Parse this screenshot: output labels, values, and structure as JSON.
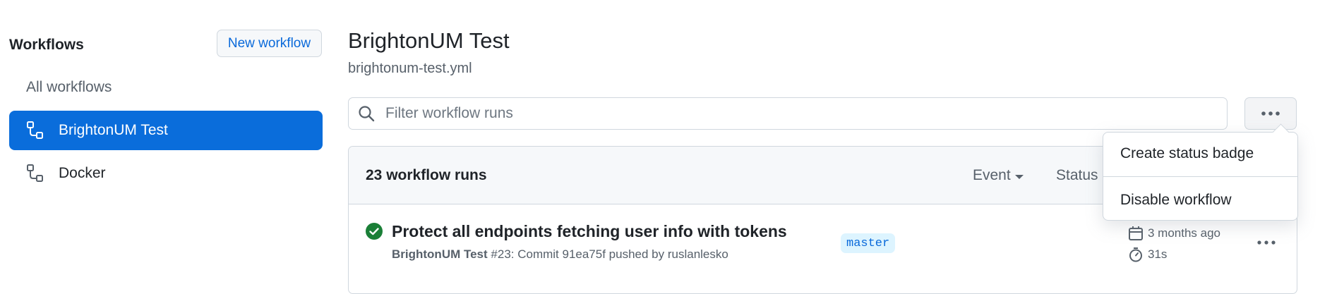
{
  "sidebar": {
    "title": "Workflows",
    "new_workflow_label": "New workflow",
    "items": [
      {
        "label": "All workflows"
      },
      {
        "label": "BrightonUM Test",
        "active": true,
        "icon": "workflow-icon"
      },
      {
        "label": "Docker",
        "icon": "workflow-icon"
      }
    ]
  },
  "header": {
    "title": "BrightonUM Test",
    "filename": "brightonum-test.yml"
  },
  "search": {
    "placeholder": "Filter workflow runs",
    "value": ""
  },
  "runs": {
    "count_label": "23 workflow runs",
    "filters": [
      {
        "label": "Event"
      },
      {
        "label": "Status"
      }
    ],
    "items": [
      {
        "title": "Protect all endpoints fetching user info with tokens",
        "workflow": "BrightonUM Test",
        "detail": "#23: Commit 91ea75f pushed by ruslanlesko",
        "branch": "master",
        "time": "3 months ago",
        "duration": "31s",
        "status": "success"
      }
    ]
  },
  "menu": {
    "items": [
      {
        "label": "Create status badge"
      },
      {
        "label": "Disable workflow"
      }
    ]
  },
  "colors": {
    "accent": "#0a6ddb",
    "link": "#0969da",
    "success": "#1a7f37",
    "muted": "#57606a"
  }
}
